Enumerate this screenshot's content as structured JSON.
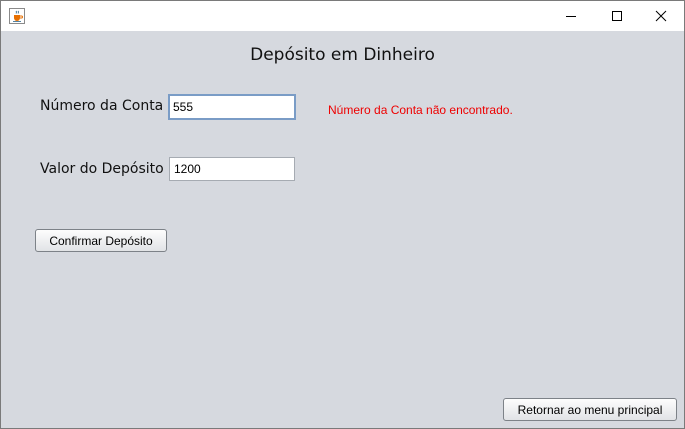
{
  "window": {
    "app_icon": "java-cup-icon",
    "controls": {
      "minimize_icon": "minimize-icon",
      "maximize_icon": "maximize-icon",
      "close_icon": "close-icon"
    }
  },
  "form": {
    "title": "Depósito em Dinheiro",
    "account_label": "Número da Conta",
    "account_value": "555",
    "amount_label": "Valor do Depósito",
    "amount_value": "1200",
    "error_message": "Número da Conta não encontrado.",
    "confirm_label": "Confirmar Depósito",
    "return_label": "Retornar ao menu principal"
  },
  "colors": {
    "background": "#d6d9df",
    "error": "#ee0000",
    "focus_border": "#7a9cc6"
  }
}
